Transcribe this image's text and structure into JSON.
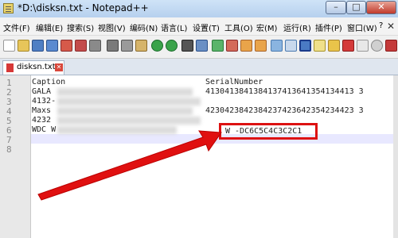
{
  "window": {
    "title": "*D:\\disksn.txt - Notepad++",
    "min": "–",
    "max": "□",
    "close": "✕"
  },
  "menu": [
    "文件(F)",
    "编辑(E)",
    "搜索(S)",
    "视图(V)",
    "编码(N)",
    "语言(L)",
    "设置(T)",
    "工具(O)",
    "宏(M)",
    "运行(R)",
    "插件(P)",
    "窗口(W)",
    "?"
  ],
  "menu_close": "✕",
  "tab": {
    "label": "disksn.txt",
    "close": "✕"
  },
  "lines": [
    {
      "num": "1",
      "text": "Caption",
      "serial": "SerialNumber"
    },
    {
      "num": "2",
      "text": "GALA",
      "serial": "4130413841384137413641354134413 3"
    },
    {
      "num": "3",
      "text": "4132-",
      "serial": ""
    },
    {
      "num": "4",
      "text": "Maxs",
      "serial": "4230423842384237423642354234423 3"
    },
    {
      "num": "5",
      "text": "4232",
      "serial": ""
    },
    {
      "num": "6",
      "text": "WDC W",
      "serial": "W -DC6C5C4C3C2C1"
    },
    {
      "num": "7",
      "text": "",
      "serial": ""
    },
    {
      "num": "8",
      "text": "",
      "serial": ""
    }
  ],
  "colors": {
    "highlight": "#d11111",
    "arrow": "#e01010"
  }
}
